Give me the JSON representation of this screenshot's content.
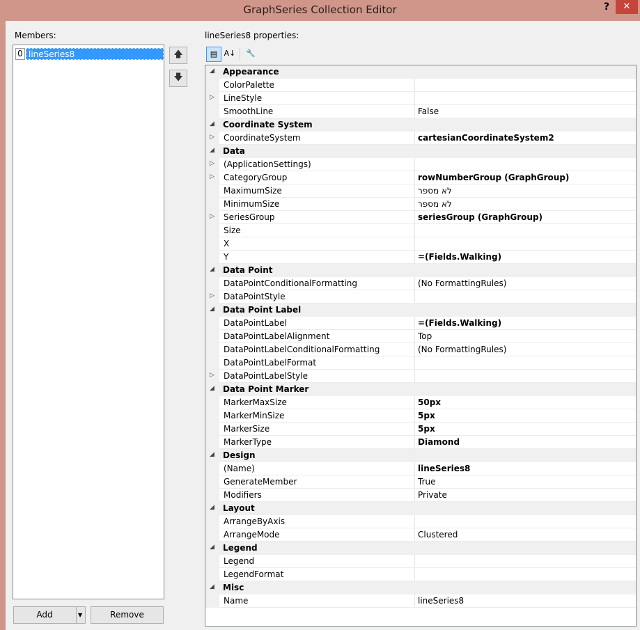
{
  "window": {
    "title": "GraphSeries Collection Editor",
    "help": "?",
    "close": "✕"
  },
  "members": {
    "label": "Members:",
    "items": [
      {
        "index": "0",
        "name": "lineSeries8"
      }
    ],
    "move_up": "🡅",
    "move_down": "🡇",
    "add_label": "Add",
    "remove_label": "Remove"
  },
  "properties": {
    "label": "lineSeries8 properties:",
    "rows": [
      {
        "type": "cat",
        "name": "Appearance"
      },
      {
        "type": "prop",
        "name": "ColorPalette",
        "value": "",
        "expand": false
      },
      {
        "type": "prop",
        "name": "LineStyle",
        "value": "",
        "expand": true
      },
      {
        "type": "prop",
        "name": "SmoothLine",
        "value": "False",
        "expand": false
      },
      {
        "type": "cat",
        "name": "Coordinate System"
      },
      {
        "type": "prop",
        "name": "CoordinateSystem",
        "value": "cartesianCoordinateSystem2",
        "expand": true,
        "bold": true
      },
      {
        "type": "cat",
        "name": "Data"
      },
      {
        "type": "prop",
        "name": "(ApplicationSettings)",
        "value": "",
        "expand": true
      },
      {
        "type": "prop",
        "name": "CategoryGroup",
        "value": "rowNumberGroup (GraphGroup)",
        "expand": true,
        "bold": true
      },
      {
        "type": "prop",
        "name": "MaximumSize",
        "value": "לא מספר",
        "expand": false
      },
      {
        "type": "prop",
        "name": "MinimumSize",
        "value": "לא מספר",
        "expand": false
      },
      {
        "type": "prop",
        "name": "SeriesGroup",
        "value": "seriesGroup (GraphGroup)",
        "expand": true,
        "bold": true
      },
      {
        "type": "prop",
        "name": "Size",
        "value": "",
        "expand": false
      },
      {
        "type": "prop",
        "name": "X",
        "value": "",
        "expand": false
      },
      {
        "type": "prop",
        "name": "Y",
        "value": "=(Fields.Walking)",
        "expand": false,
        "bold": true
      },
      {
        "type": "cat",
        "name": "Data Point"
      },
      {
        "type": "prop",
        "name": "DataPointConditionalFormatting",
        "value": "(No FormattingRules)",
        "expand": false
      },
      {
        "type": "prop",
        "name": "DataPointStyle",
        "value": "",
        "expand": true
      },
      {
        "type": "cat",
        "name": "Data Point Label"
      },
      {
        "type": "prop",
        "name": "DataPointLabel",
        "value": "=(Fields.Walking)",
        "expand": false,
        "bold": true
      },
      {
        "type": "prop",
        "name": "DataPointLabelAlignment",
        "value": "Top",
        "expand": false
      },
      {
        "type": "prop",
        "name": "DataPointLabelConditionalFormatting",
        "value": "(No FormattingRules)",
        "expand": false
      },
      {
        "type": "prop",
        "name": "DataPointLabelFormat",
        "value": "",
        "expand": false
      },
      {
        "type": "prop",
        "name": "DataPointLabelStyle",
        "value": "",
        "expand": true
      },
      {
        "type": "cat",
        "name": "Data Point Marker"
      },
      {
        "type": "prop",
        "name": "MarkerMaxSize",
        "value": "50px",
        "expand": false,
        "bold": true
      },
      {
        "type": "prop",
        "name": "MarkerMinSize",
        "value": "5px",
        "expand": false,
        "bold": true
      },
      {
        "type": "prop",
        "name": "MarkerSize",
        "value": "5px",
        "expand": false,
        "bold": true
      },
      {
        "type": "prop",
        "name": "MarkerType",
        "value": "Diamond",
        "expand": false,
        "bold": true
      },
      {
        "type": "cat",
        "name": "Design"
      },
      {
        "type": "prop",
        "name": "(Name)",
        "value": "lineSeries8",
        "expand": false,
        "bold": true
      },
      {
        "type": "prop",
        "name": "GenerateMember",
        "value": "True",
        "expand": false
      },
      {
        "type": "prop",
        "name": "Modifiers",
        "value": "Private",
        "expand": false
      },
      {
        "type": "cat",
        "name": "Layout"
      },
      {
        "type": "prop",
        "name": "ArrangeByAxis",
        "value": "",
        "expand": false
      },
      {
        "type": "prop",
        "name": "ArrangeMode",
        "value": "Clustered",
        "expand": false
      },
      {
        "type": "cat",
        "name": "Legend"
      },
      {
        "type": "prop",
        "name": "Legend",
        "value": "",
        "expand": false
      },
      {
        "type": "prop",
        "name": "LegendFormat",
        "value": "",
        "expand": false
      },
      {
        "type": "cat",
        "name": "Misc"
      },
      {
        "type": "prop",
        "name": "Name",
        "value": "lineSeries8",
        "expand": false
      }
    ]
  },
  "toolbar": {
    "categorized_icon": "▤",
    "alphabetical_icon": "A↓",
    "property_pages_icon": "🔧"
  },
  "colors": {
    "titlebar": "#d1968a",
    "close": "#c7443a",
    "selection": "#3399ff"
  }
}
